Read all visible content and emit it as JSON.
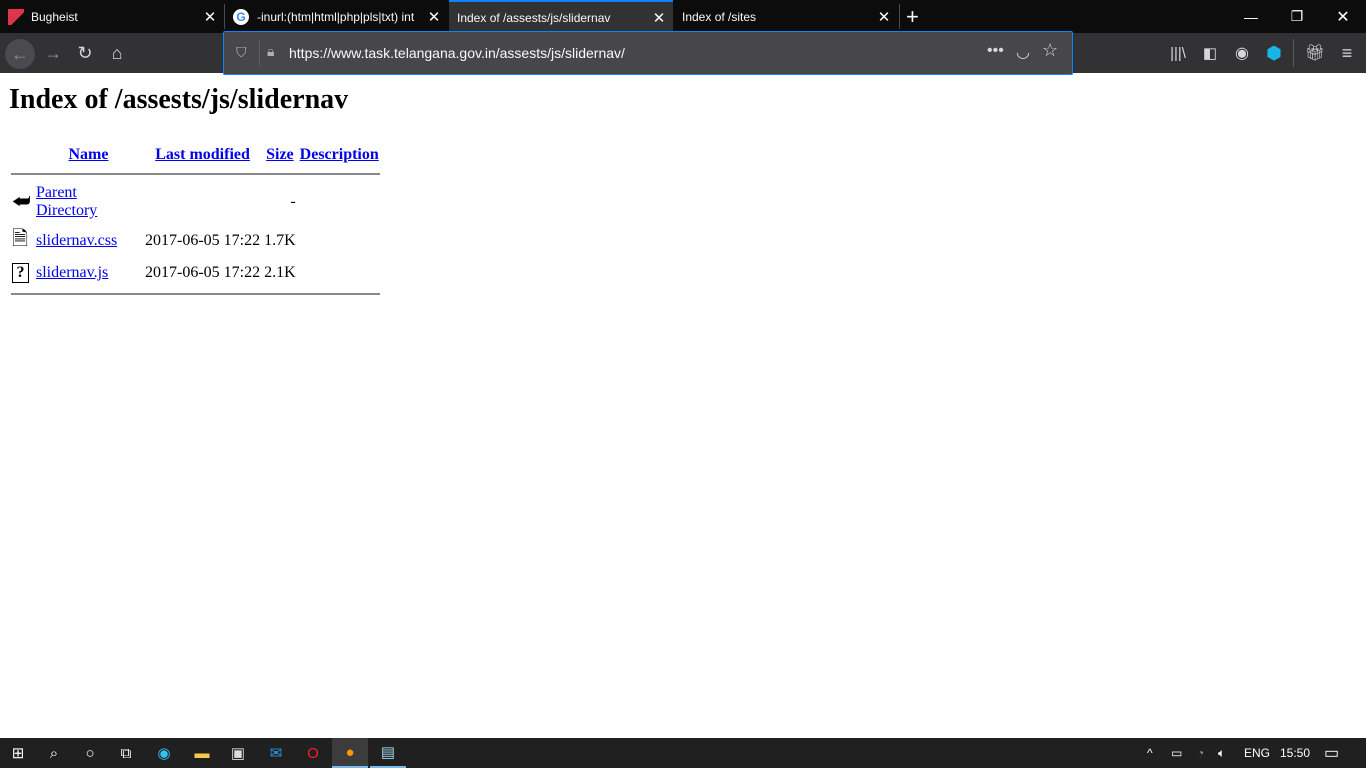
{
  "browser": {
    "tabs": [
      {
        "label": "Bugheist",
        "icon": "bugheist-logo-icon",
        "active": false
      },
      {
        "label": "-inurl:(htm|html|php|pls|txt) int",
        "icon": "google-icon",
        "active": false
      },
      {
        "label": "Index of /assests/js/slidernav",
        "active": true
      },
      {
        "label": "Index of /sites",
        "active": false
      }
    ],
    "url": "https://www.task.telangana.gov.in/assests/js/slidernav/",
    "accent": "#0a84ff"
  },
  "page": {
    "title": "Index of /assests/js/slidernav",
    "columns": [
      "Name",
      "Last modified",
      "Size",
      "Description"
    ],
    "rows": [
      {
        "icon": "back-arrow-icon",
        "name": "Parent Directory",
        "modified": "",
        "size": "-",
        "description": ""
      },
      {
        "icon": "text-file-icon",
        "name": "slidernav.css",
        "modified": "2017-06-05 17:22",
        "size": "1.7K",
        "description": ""
      },
      {
        "icon": "unknown-file-icon",
        "name": "slidernav.js",
        "modified": "2017-06-05 17:22",
        "size": "2.1K",
        "description": ""
      }
    ]
  },
  "taskbar": {
    "language": "ENG",
    "time": "15:50"
  }
}
